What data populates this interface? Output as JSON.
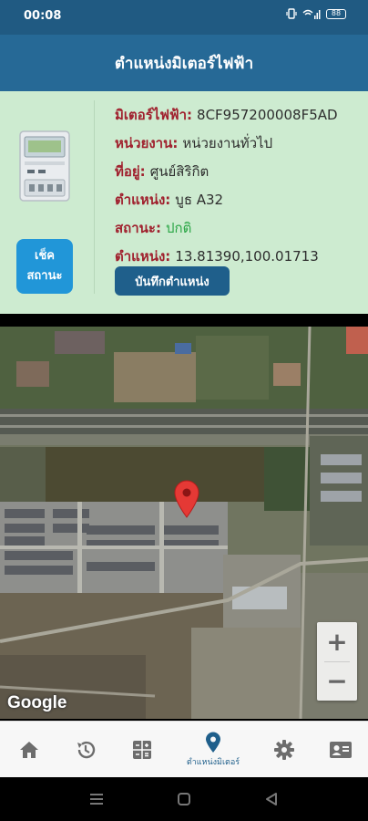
{
  "status_bar": {
    "time": "00:08",
    "battery": "88",
    "signal_icons": [
      "vibrate-icon",
      "wifi-icon",
      "signal-icon",
      "battery-icon"
    ]
  },
  "app_bar": {
    "title": "ตำแหน่งมิเตอร์ไฟฟ้า"
  },
  "meter_card": {
    "rows": [
      {
        "label": "มิเตอร์ไฟฟ้า:",
        "value": "8CF957200008F5AD"
      },
      {
        "label": "หน่วยงาน:",
        "value": "หน่วยงานทั่วไป"
      },
      {
        "label": "ที่อยู่:",
        "value": "ศูนย์สิริกิต"
      },
      {
        "label": "ตำแหน่ง:",
        "value": "บูธ A32"
      },
      {
        "label": "สถานะ:",
        "value": "ปกติ"
      },
      {
        "label": "ตำแหน่ง:",
        "value": "13.81390,100.01713"
      }
    ],
    "status_value_color": "#2aa645",
    "label_color": "#a0212e",
    "check_status_button": {
      "line1": "เช็ค",
      "line2": "สถานะ"
    },
    "save_location_button": "บันทึกตำแหน่ง"
  },
  "map": {
    "attribution": "Google",
    "zoom_in_label": "+",
    "zoom_out_label": "−",
    "marker_color": "#e53935"
  },
  "bottom_nav": {
    "items": [
      {
        "icon": "home-icon",
        "label": ""
      },
      {
        "icon": "history-icon",
        "label": ""
      },
      {
        "icon": "calculator-icon",
        "label": ""
      },
      {
        "icon": "location-pin-icon",
        "label": "ตำแหน่งมิเตอร์"
      },
      {
        "icon": "gear-icon",
        "label": ""
      },
      {
        "icon": "contact-card-icon",
        "label": ""
      }
    ],
    "active_index": 3,
    "active_color": "#1f5f8b",
    "inactive_color": "#6d6d6d"
  },
  "colors": {
    "primary": "#266996",
    "status_bar": "#205a82",
    "card_background": "#cdebd0",
    "button_blue": "#2196d8"
  }
}
